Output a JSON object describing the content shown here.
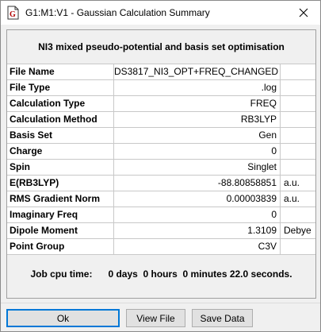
{
  "window": {
    "title": "G1:M1:V1 - Gaussian Calculation Summary"
  },
  "summary": {
    "heading": "NI3 mixed pseudo-potential and basis set optimisation",
    "rows": [
      {
        "label": "File Name",
        "value": "DS3817_NI3_OPT+FREQ_CHANGED",
        "unit": ""
      },
      {
        "label": "File Type",
        "value": ".log",
        "unit": ""
      },
      {
        "label": "Calculation Type",
        "value": "FREQ",
        "unit": ""
      },
      {
        "label": "Calculation Method",
        "value": "RB3LYP",
        "unit": ""
      },
      {
        "label": "Basis Set",
        "value": "Gen",
        "unit": ""
      },
      {
        "label": "Charge",
        "value": "0",
        "unit": ""
      },
      {
        "label": "Spin",
        "value": "Singlet",
        "unit": ""
      },
      {
        "label": "E(RB3LYP)",
        "value": "-88.80858851",
        "unit": "a.u."
      },
      {
        "label": "RMS Gradient Norm",
        "value": "0.00003839",
        "unit": "a.u."
      },
      {
        "label": "Imaginary Freq",
        "value": "0",
        "unit": ""
      },
      {
        "label": "Dipole Moment",
        "value": "1.3109",
        "unit": "Debye"
      },
      {
        "label": "Point Group",
        "value": "C3V",
        "unit": ""
      }
    ],
    "cpu_time": "Job cpu time:      0 days  0 hours  0 minutes 22.0 seconds."
  },
  "buttons": {
    "ok": "Ok",
    "view_file": "View File",
    "save_data": "Save Data"
  },
  "icons": {
    "app": "gaussian-document-icon",
    "close": "close-icon"
  }
}
